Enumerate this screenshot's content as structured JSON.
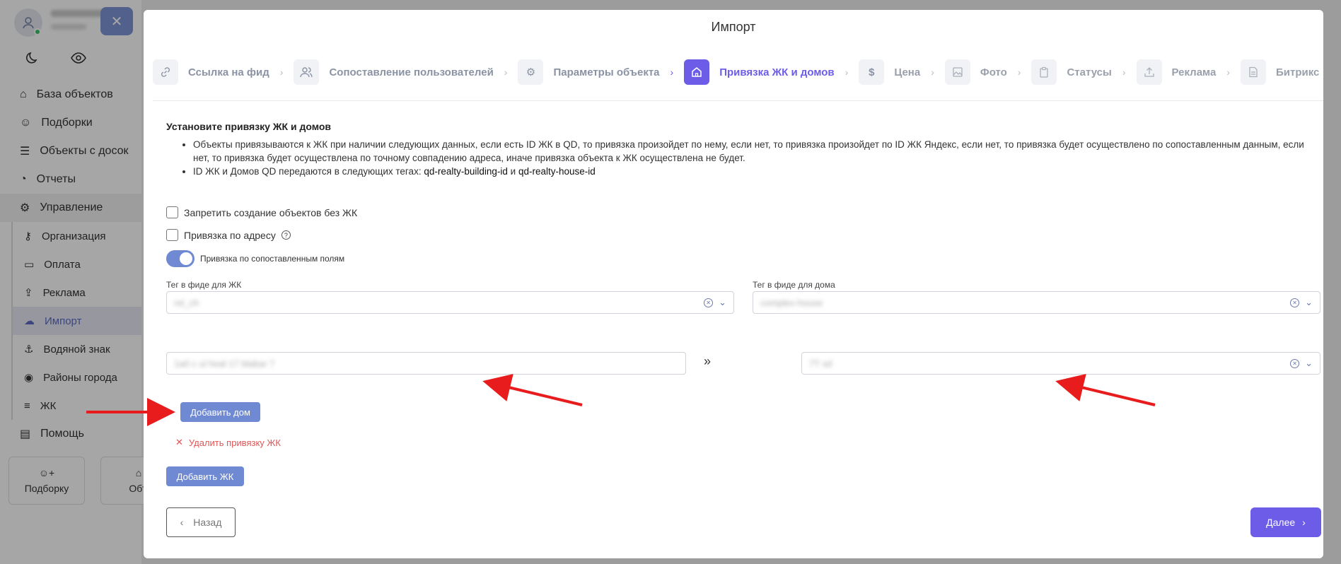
{
  "sidebar": {
    "menu": [
      {
        "label": "База объектов",
        "icon": "home-icon"
      },
      {
        "label": "Подборки",
        "icon": "users-icon"
      },
      {
        "label": "Объекты с досок",
        "icon": "server-icon"
      },
      {
        "label": "Отчеты",
        "icon": "pie-chart-icon"
      },
      {
        "label": "Управление",
        "icon": "gear-icon"
      }
    ],
    "submenu": [
      {
        "label": "Организация",
        "icon": "key-icon"
      },
      {
        "label": "Оплата",
        "icon": "credit-card-icon"
      },
      {
        "label": "Реклама",
        "icon": "upload-icon"
      },
      {
        "label": "Импорт",
        "icon": "cloud-upload-icon"
      },
      {
        "label": "Водяной знак",
        "icon": "anchor-icon"
      },
      {
        "label": "Районы города",
        "icon": "map-pin-icon"
      },
      {
        "label": "ЖК",
        "icon": "list-icon"
      }
    ],
    "help": "Помощь",
    "cards": [
      "Подборку",
      "Объ"
    ]
  },
  "modal": {
    "title": "Импорт",
    "steps": [
      {
        "label": "Ссылка на фид",
        "icon": "link-icon"
      },
      {
        "label": "Сопоставление пользователей",
        "icon": "users-icon"
      },
      {
        "label": "Параметры объекта",
        "icon": "gear-icon"
      },
      {
        "label": "Привязка ЖК и домов",
        "icon": "home-icon"
      },
      {
        "label": "Цена",
        "icon": "dollar-icon"
      },
      {
        "label": "Фото",
        "icon": "image-icon"
      },
      {
        "label": "Статусы",
        "icon": "clipboard-icon"
      },
      {
        "label": "Реклама",
        "icon": "upload-icon"
      },
      {
        "label": "Битрикс",
        "icon": "document-icon"
      }
    ],
    "heading": "Установите привязку ЖК и домов",
    "bullet1": "Объекты привязываются к ЖК при наличии следующих данных, если есть ID ЖК в QD, то привязка произойдет по нему, если нет, то привязка произойдет по ID ЖК Яндекс, если нет, то привязка будет осуществлено по сопоставленным данным, если нет, то привязка будет осуществлена по точному совпадению адреса, иначе привязка объекта к ЖК осуществлена не будет.",
    "bullet2_prefix": "ID ЖК и Домов QD передаются в следующих тегах:",
    "bullet2_tag1": "qd-realty-building-id",
    "bullet2_and": "и",
    "bullet2_tag2": "qd-realty-house-id",
    "checkbox1": "Запретить создание объектов без ЖК",
    "checkbox2": "Привязка по адресу",
    "toggle_label": "Привязка по сопоставленным полям",
    "tag_zhk_label": "Тег в фиде для ЖК",
    "tag_zhk_value": "rel_ch",
    "tag_house_label": "Тег в фиде для дома",
    "tag_house_value": "complex-house",
    "map_left_value": "1a0 c ul heal 17 blabar 7",
    "map_sep": "»",
    "map_right_value": "7T sd",
    "add_house": "Добавить дом",
    "delete_zhk": "Удалить привязку ЖК",
    "add_zhk": "Добавить ЖК",
    "back": "Назад",
    "next": "Далее"
  }
}
